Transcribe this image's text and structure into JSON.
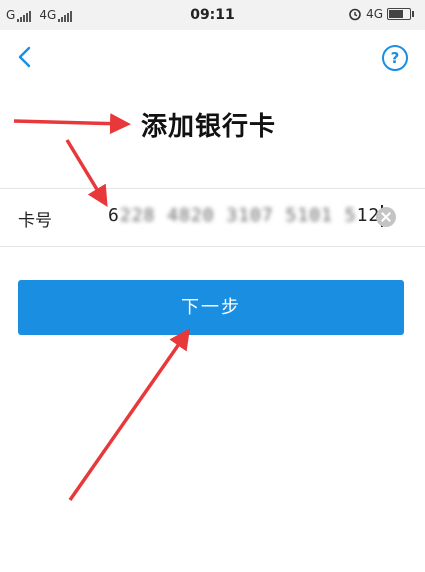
{
  "status_bar": {
    "carrier1": "G",
    "carrier2": "4G",
    "time": "09:11",
    "right_network": "4G"
  },
  "nav": {
    "back_icon": "chevron-left-icon",
    "help_icon": "help-circle-icon",
    "help_label": "?"
  },
  "page": {
    "title": "添加银行卡"
  },
  "card_field": {
    "label": "卡号",
    "value_first": "6",
    "value_masked": "228 4820 3107 5101 5",
    "value_last": "12",
    "clear_icon": "clear-icon"
  },
  "next_button": {
    "label": "下一步"
  },
  "colors": {
    "accent": "#1a8fe2",
    "annotation_arrow": "#e8383a",
    "battery_level_percent": 70
  }
}
